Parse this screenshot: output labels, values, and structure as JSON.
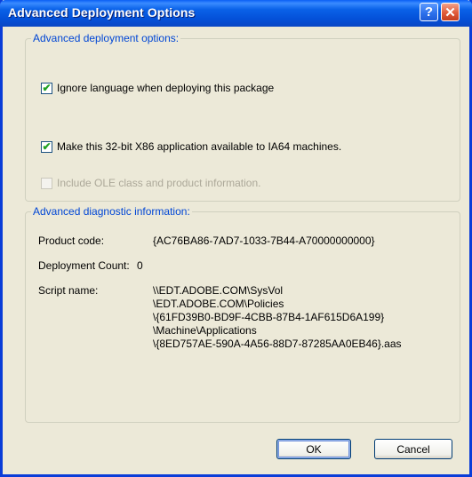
{
  "window": {
    "title": "Advanced Deployment Options",
    "help_glyph": "?",
    "close_glyph": "✕"
  },
  "deploy_group": {
    "legend": "Advanced deployment options:",
    "options": [
      {
        "label": "Ignore language when deploying this package",
        "checked": true,
        "enabled": true
      },
      {
        "label": "Make this 32-bit X86 application available to IA64 machines.",
        "checked": true,
        "enabled": true
      },
      {
        "label": "Include OLE class and product information.",
        "checked": false,
        "enabled": false
      }
    ]
  },
  "diag_group": {
    "legend": "Advanced diagnostic information:",
    "product_code_label": "Product code:",
    "product_code_value": "{AC76BA86-7AD7-1033-7B44-A70000000000}",
    "deployment_count_label": "Deployment Count:",
    "deployment_count_value": "0",
    "script_name_label": "Script name:",
    "script_name_lines": [
      "\\\\EDT.ADOBE.COM\\SysVol",
      "\\EDT.ADOBE.COM\\Policies",
      "\\{61FD39B0-BD9F-4CBB-87B4-1AF615D6A199}",
      "\\Machine\\Applications",
      "\\{8ED757AE-590A-4A56-88D7-87285AA0EB46}.aas"
    ]
  },
  "buttons": {
    "ok": "OK",
    "cancel": "Cancel"
  },
  "check_glyph": "✔"
}
